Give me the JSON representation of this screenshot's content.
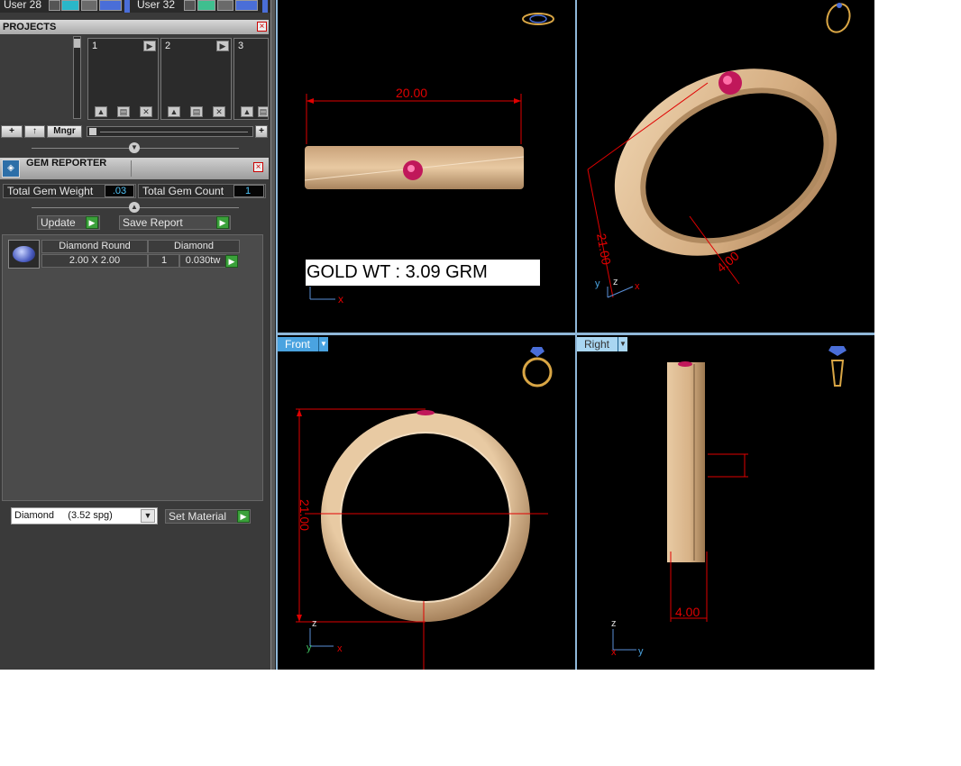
{
  "users": [
    {
      "label": "User 28"
    },
    {
      "label": "User 32"
    }
  ],
  "projects": {
    "title": "PROJECTS",
    "slots": [
      "1",
      "2",
      "3"
    ],
    "manager_label": "Mngr"
  },
  "gem_reporter": {
    "title": "GEM REPORTER",
    "total_weight_label": "Total Gem Weight",
    "total_weight_value": ".03",
    "total_count_label": "Total Gem Count",
    "total_count_value": "1",
    "update_label": "Update",
    "save_report_label": "Save Report",
    "gems": [
      {
        "shape": "Diamond Round",
        "size": "2.00 X 2.00",
        "material": "Diamond",
        "count": "1",
        "weight": "0.030tw"
      }
    ],
    "material_select": "Diamond     (3.52 spg)",
    "set_material_label": "Set Material"
  },
  "viewports": {
    "top_left": {
      "dim_width": "20.00",
      "gold_weight": "GOLD WT : 3.09 GRM",
      "axis_x": "x"
    },
    "top_right": {
      "dim_diameter": "21.00",
      "dim_side": "4.00",
      "axis_y": "y",
      "axis_z": "z",
      "axis_x": "x"
    },
    "front": {
      "label": "Front",
      "dim_diameter": "21.00",
      "axis_z": "z",
      "axis_y": "y",
      "axis_x": "x"
    },
    "right": {
      "label": "Right",
      "dim_width": "4.00",
      "axis_z": "z",
      "axis_x": "x",
      "axis_y": "y"
    }
  },
  "colors": {
    "panel_bg": "#3a3a3a",
    "viewport_bg": "#000000",
    "dimension_red": "#e00000",
    "gold": "#d9b48a",
    "ruby": "#c0175a",
    "view_label_blue": "#4aa3e0",
    "viewport_border": "#8fb7d8"
  }
}
